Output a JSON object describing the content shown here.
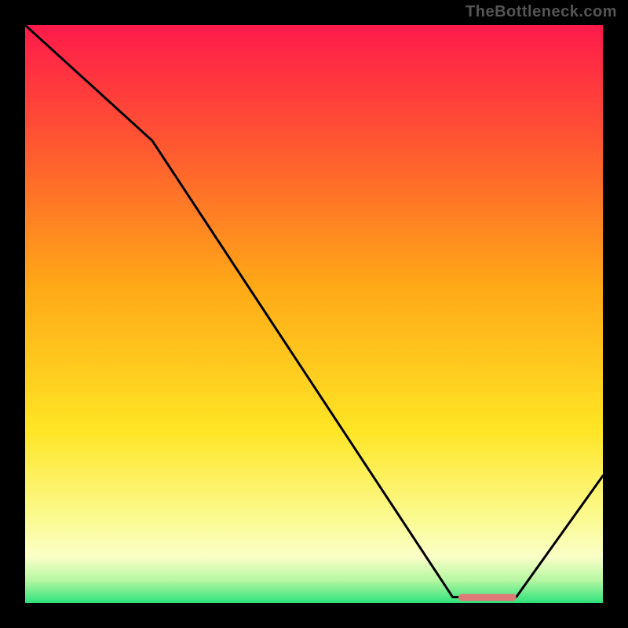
{
  "watermark": "TheBottleneck.com",
  "colors": {
    "background": "#000000",
    "curve": "#000000",
    "marker": "#dd7a76",
    "gradient_stops": [
      {
        "offset": "0%",
        "color": "#ff1a4b"
      },
      {
        "offset": "20%",
        "color": "#ff5532"
      },
      {
        "offset": "45%",
        "color": "#ffa817"
      },
      {
        "offset": "70%",
        "color": "#ffe524"
      },
      {
        "offset": "85%",
        "color": "#fbfa8e"
      },
      {
        "offset": "92%",
        "color": "#faffc7"
      },
      {
        "offset": "96%",
        "color": "#b8f7a3"
      },
      {
        "offset": "100%",
        "color": "#30e27c"
      }
    ]
  },
  "chart_data": {
    "type": "line",
    "title": "",
    "xlabel": "",
    "ylabel": "",
    "xlim": [
      0,
      100
    ],
    "ylim": [
      0,
      100
    ],
    "series": [
      {
        "name": "bottleneck-curve",
        "x": [
          0,
          22,
          74,
          85,
          100
        ],
        "y": [
          100,
          80,
          1,
          1,
          22
        ]
      }
    ],
    "annotations": [
      {
        "name": "optimal-marker",
        "x_start": 75,
        "x_end": 85,
        "y": 1
      }
    ]
  }
}
